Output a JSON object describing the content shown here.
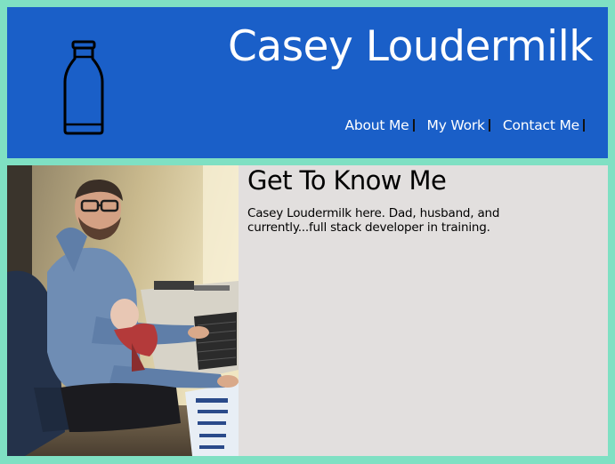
{
  "header": {
    "title": "Casey Loudermilk",
    "logo_icon": "milk-bottle-icon",
    "background_color": "#1a5fc8"
  },
  "nav": {
    "items": [
      {
        "label": "About Me"
      },
      {
        "label": "My Work"
      },
      {
        "label": "Contact Me"
      }
    ]
  },
  "about": {
    "heading": "Get To Know Me",
    "text": "Casey Loudermilk here. Dad, husband, and currently...full stack developer in training.",
    "photo_icon": "profile-photo"
  },
  "colors": {
    "page_background": "#7fe0c3",
    "section_background": "#e2dfde",
    "header_text": "#ffffff"
  }
}
